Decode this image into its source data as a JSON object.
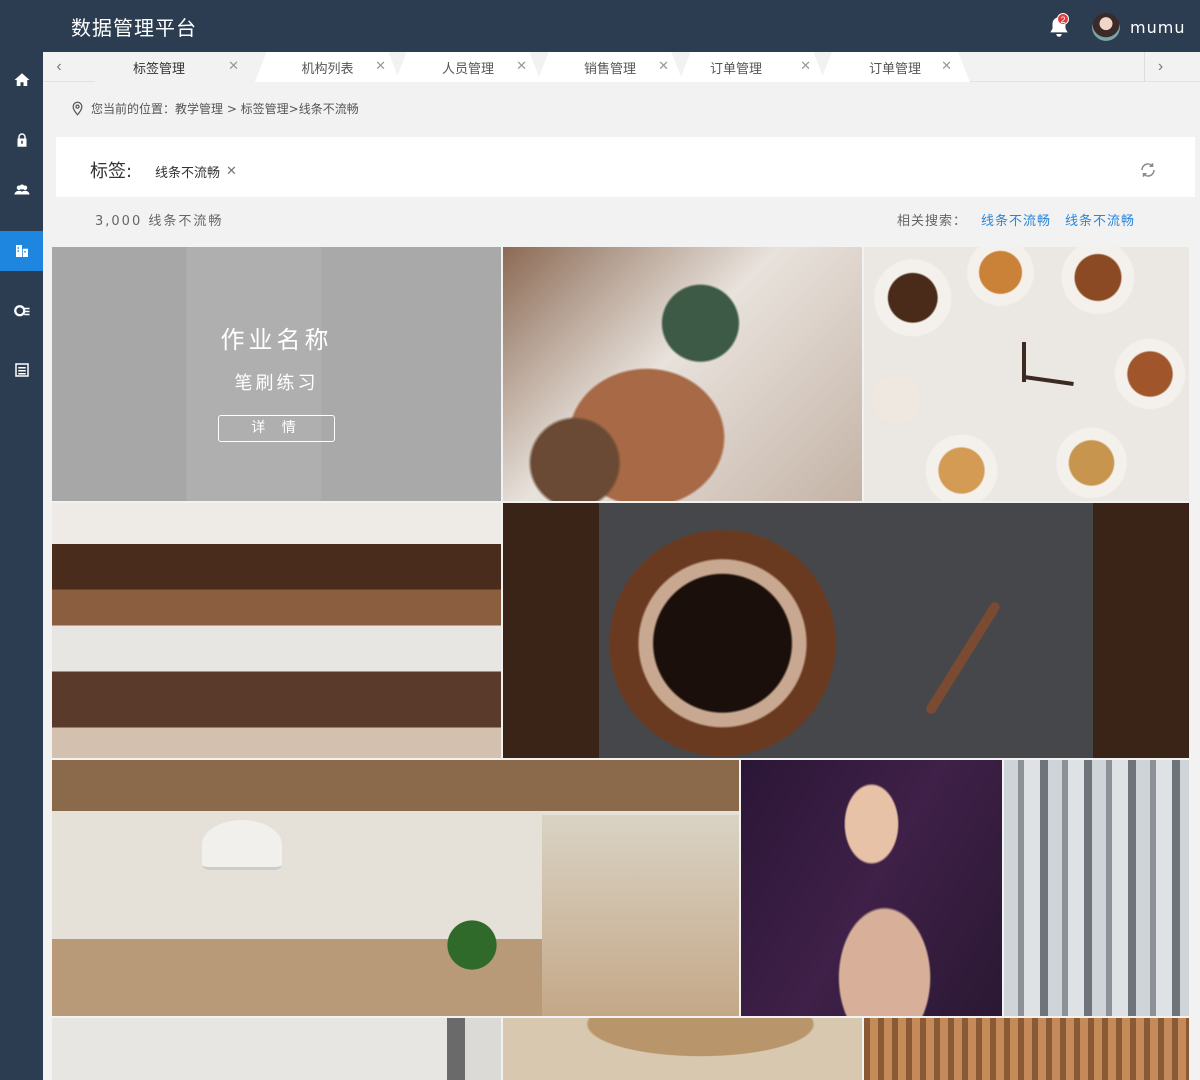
{
  "header": {
    "title": "数据管理平台",
    "username": "mumu",
    "notification_count": "2"
  },
  "sidebar": {
    "items": [
      {
        "icon": "home-icon"
      },
      {
        "icon": "lock-icon"
      },
      {
        "icon": "users-icon"
      },
      {
        "icon": "building-icon",
        "active": true
      },
      {
        "icon": "settings-icon"
      },
      {
        "icon": "list-icon"
      }
    ]
  },
  "tabs": [
    {
      "label": "标签管理",
      "active": true
    },
    {
      "label": "机构列表"
    },
    {
      "label": "人员管理"
    },
    {
      "label": "销售管理"
    },
    {
      "label": "订单管理"
    },
    {
      "label": "订单管理"
    }
  ],
  "breadcrumb": {
    "text": "您当前的位置：教学管理 > 标签管理>线条不流畅"
  },
  "tag_filter": {
    "label": "标签:",
    "tag": "线条不流畅"
  },
  "results": {
    "count_text": "3,000  线条不流畅"
  },
  "related": {
    "label": "相关搜索：",
    "links": [
      "线条不流畅",
      "线条不流畅"
    ]
  },
  "gallery": {
    "featured": {
      "title": "作业名称",
      "subtitle": "笔刷练习",
      "button": "详 情"
    },
    "tiles": [
      "interior-room-image",
      "plant-coffee-image",
      "coffee-clock-image",
      "coffee-layers-image",
      "coffee-cup-image",
      "dining-room-image",
      "woman-portrait-image",
      "forest-painting-image",
      "interior-image",
      "basket-image",
      "wood-interior-image"
    ]
  },
  "colors": {
    "header_bg": "#2c3d52",
    "accent": "#1f86e0",
    "link": "#2a86d8",
    "badge": "#e03b3b"
  }
}
